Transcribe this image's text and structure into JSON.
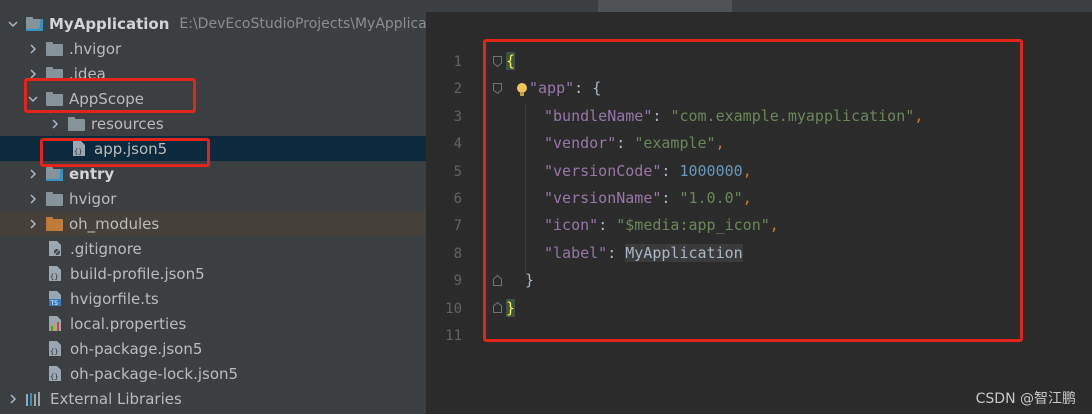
{
  "tree": {
    "root": {
      "name": "MyApplication",
      "path": "E:\\DevEcoStudioProjects\\MyApplica"
    },
    "hvigor_dir": ".hvigor",
    "idea_dir": ".idea",
    "appscope": "AppScope",
    "resources": "resources",
    "app_json5": "app.json5",
    "entry": "entry",
    "hvigor": "hvigor",
    "oh_modules": "oh_modules",
    "gitignore": ".gitignore",
    "build_profile": "build-profile.json5",
    "hvigorfile": "hvigorfile.ts",
    "local_properties": "local.properties",
    "oh_package": "oh-package.json5",
    "oh_package_lock": "oh-package-lock.json5",
    "external_libraries": "External Libraries"
  },
  "editor": {
    "line_numbers": [
      "1",
      "2",
      "3",
      "4",
      "5",
      "6",
      "7",
      "8",
      "9",
      "10",
      "11"
    ],
    "code": {
      "open_brace": "{",
      "app_key": "\"app\"",
      "colon_brace": ": {",
      "bundleName_key": "\"bundleName\"",
      "bundleName_val": "\"com.example.myapplication\"",
      "vendor_key": "\"vendor\"",
      "vendor_val": "\"example\"",
      "versionCode_key": "\"versionCode\"",
      "versionCode_val": "1000000",
      "versionName_key": "\"versionName\"",
      "versionName_val": "\"1.0.0\"",
      "icon_key": "\"icon\"",
      "icon_val": "\"$media:app_icon\"",
      "label_key": "\"label\"",
      "label_val": "MyApplication",
      "inner_close": "}",
      "close_brace": "}",
      "colon": ": ",
      "comma": ","
    }
  },
  "watermark": "CSDN @智江鹏",
  "colors": {
    "annotation_red": "#e3241d",
    "selection": "#0d293e"
  }
}
